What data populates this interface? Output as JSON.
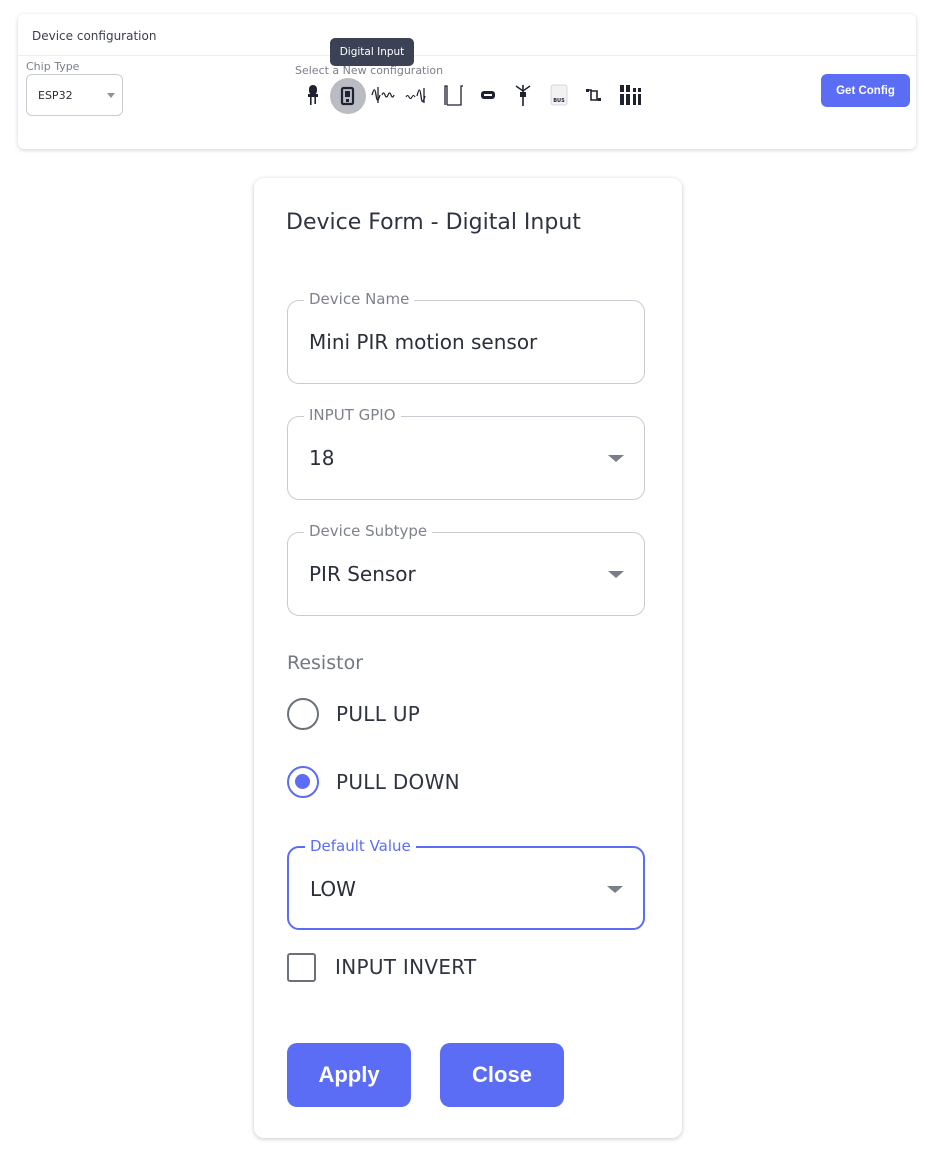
{
  "config_bar": {
    "title": "Device configuration",
    "chip_type_label": "Chip Type",
    "chip_type_value": "ESP32",
    "new_config_label": "Select a New configuration",
    "tooltip": "Digital Input",
    "get_config_label": "Get Config",
    "device_icons": [
      "led-icon",
      "digital-input-icon",
      "pwm-signal-icon",
      "analog-signal-icon",
      "pulse-icon",
      "oled-display-icon",
      "antenna-icon",
      "bus-icon",
      "relay-icon",
      "connector-pins-icon"
    ],
    "selected_icon": "digital-input-icon"
  },
  "form": {
    "title": "Device Form - Digital Input",
    "device_name": {
      "label": "Device Name",
      "value": "Mini PIR motion sensor"
    },
    "input_gpio": {
      "label": "INPUT GPIO",
      "value": "18"
    },
    "device_subtype": {
      "label": "Device Subtype",
      "value": "PIR Sensor"
    },
    "resistor": {
      "label": "Resistor",
      "options": [
        "PULL UP",
        "PULL DOWN"
      ],
      "selected": "PULL DOWN"
    },
    "default_value": {
      "label": "Default Value",
      "value": "LOW"
    },
    "input_invert": {
      "label": "INPUT INVERT",
      "checked": false
    },
    "apply_label": "Apply",
    "close_label": "Close"
  },
  "colors": {
    "accent": "#5b6cf5",
    "tooltip_bg": "#3b4256",
    "selected_icon_bg": "#b9bcc3"
  }
}
